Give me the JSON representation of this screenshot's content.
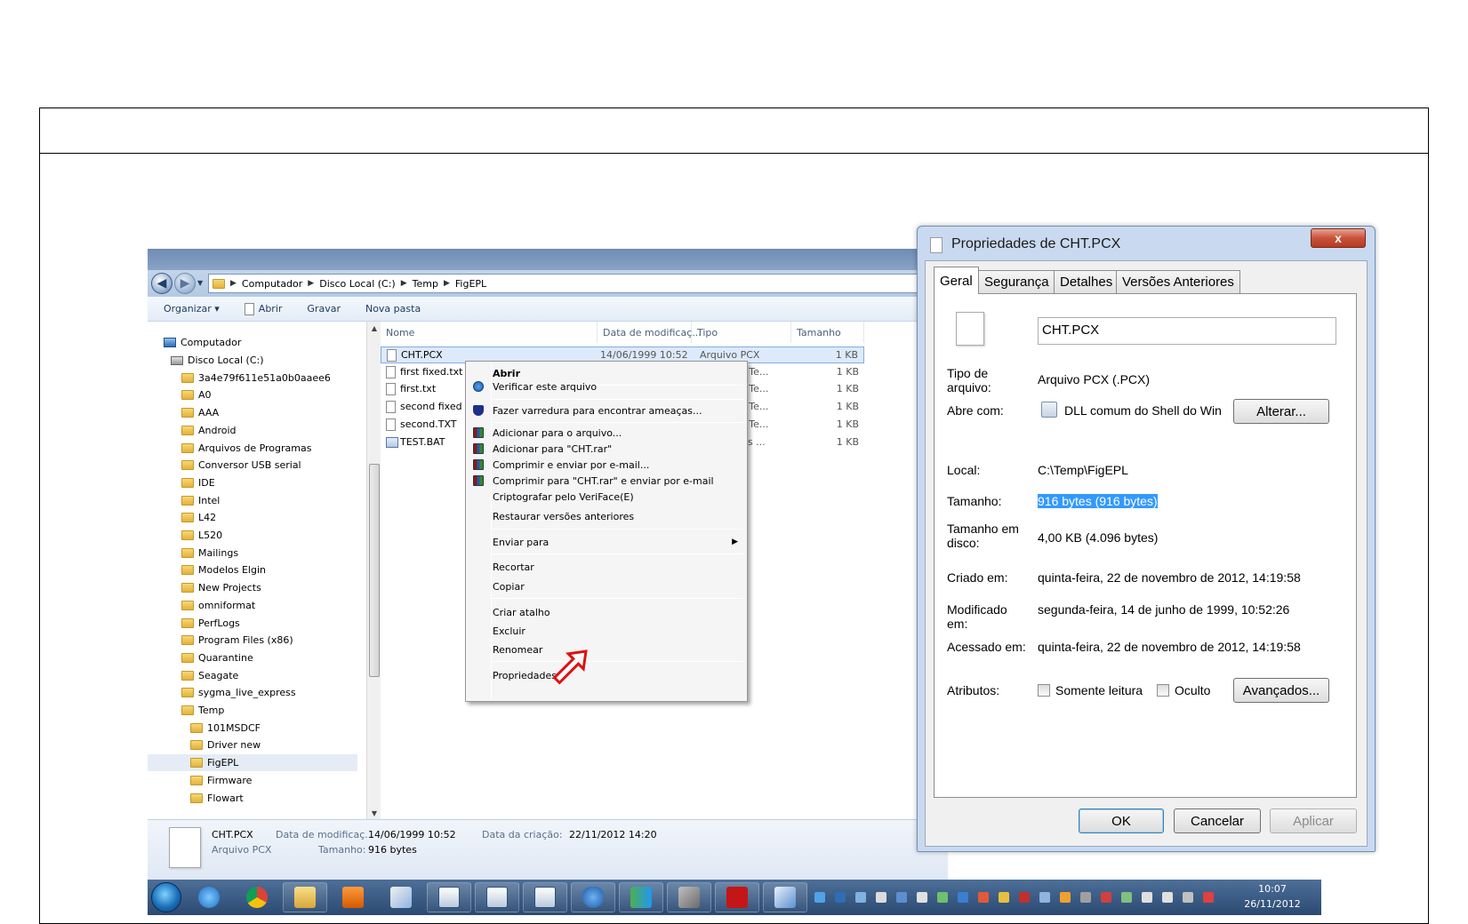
{
  "explorer": {
    "breadcrumb": [
      "Computador",
      "Disco Local (C:)",
      "Temp",
      "FigEPL"
    ],
    "toolbar": {
      "organize": "Organizar ▾",
      "open": "Abrir",
      "burn": "Gravar",
      "new_folder": "Nova pasta"
    },
    "tree": [
      {
        "label": "Computador",
        "level": 0,
        "icon": "computer-icon"
      },
      {
        "label": "Disco Local (C:)",
        "level": 1,
        "icon": "drive-icon"
      },
      {
        "label": "3a4e79f611e51a0b0aaee6",
        "level": 2
      },
      {
        "label": "A0",
        "level": 2
      },
      {
        "label": "AAA",
        "level": 2
      },
      {
        "label": "Android",
        "level": 2
      },
      {
        "label": "Arquivos de Programas",
        "level": 2
      },
      {
        "label": "Conversor USB serial",
        "level": 2
      },
      {
        "label": "IDE",
        "level": 2
      },
      {
        "label": "Intel",
        "level": 2
      },
      {
        "label": "L42",
        "level": 2
      },
      {
        "label": "L520",
        "level": 2
      },
      {
        "label": "Mailings",
        "level": 2
      },
      {
        "label": "Modelos Elgin",
        "level": 2
      },
      {
        "label": "New Projects",
        "level": 2
      },
      {
        "label": "omniformat",
        "level": 2
      },
      {
        "label": "PerfLogs",
        "level": 2
      },
      {
        "label": "Program Files (x86)",
        "level": 2
      },
      {
        "label": "Quarantine",
        "level": 2
      },
      {
        "label": "Seagate",
        "level": 2
      },
      {
        "label": "sygma_live_express",
        "level": 2
      },
      {
        "label": "Temp",
        "level": 2
      },
      {
        "label": "101MSDCF",
        "level": 3
      },
      {
        "label": "Driver new",
        "level": 3
      },
      {
        "label": "FigEPL",
        "level": 3,
        "selected": true
      },
      {
        "label": "Firmware",
        "level": 3
      },
      {
        "label": "Flowart",
        "level": 3
      }
    ],
    "columns": {
      "name": "Nome",
      "date": "Data de modificaç...",
      "type": "Tipo",
      "size": "Tamanho"
    },
    "files": [
      {
        "name": "CHT.PCX",
        "date": "14/06/1999 10:52",
        "type": "Arquivo PCX",
        "size": "1 KB",
        "selected": true
      },
      {
        "name": "first fixed.txt",
        "date": "",
        "type": "mento de Te...",
        "size": "1 KB"
      },
      {
        "name": "first.txt",
        "date": "",
        "type": "mento de Te...",
        "size": "1 KB"
      },
      {
        "name": "second fixed",
        "date": "",
        "type": "mento de Te...",
        "size": "1 KB"
      },
      {
        "name": "second.TXT",
        "date": "",
        "type": "mento de Te...",
        "size": "1 KB"
      },
      {
        "name": "TEST.BAT",
        "date": "",
        "type": "o em Lotes ...",
        "size": "1 KB"
      }
    ],
    "details": {
      "name": "CHT.PCX",
      "type": "Arquivo PCX",
      "modified_label": "Data de modificaç...",
      "modified_value": "14/06/1999 10:52",
      "size_label": "Tamanho:",
      "size_value": "916 bytes",
      "created_label": "Data da criação:",
      "created_value": "22/11/2012 14:20"
    }
  },
  "context_menu": {
    "open": "Abrir",
    "scan": "Verificar este arquivo",
    "sweep": "Fazer varredura para encontrar ameaças...",
    "add_archive": "Adicionar para o arquivo...",
    "add_rar": "Adicionar para \"CHT.rar\"",
    "compress_email": "Comprimir e enviar por e-mail...",
    "compress_rar_email": "Comprimir para \"CHT.rar\" e enviar por e-mail",
    "encrypt": "Criptografar pelo VeriFace(E)",
    "restore": "Restaurar versões anteriores",
    "send_to": "Enviar para",
    "cut": "Recortar",
    "copy": "Copiar",
    "shortcut": "Criar atalho",
    "delete": "Excluir",
    "rename": "Renomear",
    "properties": "Propriedades"
  },
  "props": {
    "title": "Propriedades de CHT.PCX",
    "close": "x",
    "tabs": [
      "Geral",
      "Segurança",
      "Detalhes",
      "Versões Anteriores"
    ],
    "filename": "CHT.PCX",
    "type_label": "Tipo de arquivo:",
    "type_value": "Arquivo PCX (.PCX)",
    "opens_label": "Abre com:",
    "opens_value": "DLL comum do Shell do Win",
    "change_btn": "Alterar...",
    "location_label": "Local:",
    "location_value": "C:\\Temp\\FigEPL",
    "size_label": "Tamanho:",
    "size_value": "916 bytes (916 bytes)",
    "disk_label": "Tamanho em disco:",
    "disk_value": "4,00 KB (4.096 bytes)",
    "created_label": "Criado em:",
    "created_value": "quinta-feira, 22 de novembro de 2012, 14:19:58",
    "modified_label": "Modificado em:",
    "modified_value": "segunda-feira, 14 de junho de 1999, 10:52:26",
    "accessed_label": "Acessado em:",
    "accessed_value": "quinta-feira, 22 de novembro de 2012, 14:19:58",
    "attributes_label": "Atributos:",
    "readonly_label": "Somente leitura",
    "hidden_label": "Oculto",
    "advanced_btn": "Avançados...",
    "ok": "OK",
    "cancel": "Cancelar",
    "apply": "Aplicar"
  },
  "taskbar": {
    "time": "10:07",
    "date": "26/11/2012"
  }
}
